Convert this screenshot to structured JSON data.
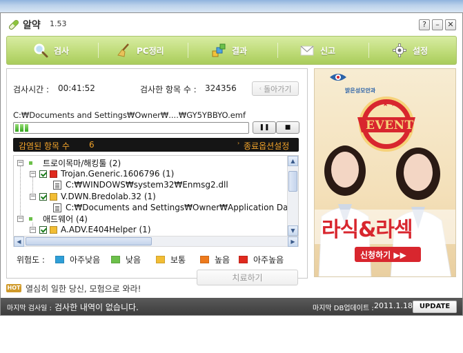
{
  "app": {
    "title": "알약",
    "version": "1.53"
  },
  "window_controls": {
    "help": "?",
    "minimize": "–",
    "close": "✕"
  },
  "toolbar": {
    "items": [
      {
        "label": "검사",
        "icon": "magnifier-icon"
      },
      {
        "label": "PC정리",
        "icon": "broom-icon"
      },
      {
        "label": "결과",
        "icon": "result-boxes-icon"
      },
      {
        "label": "신고",
        "icon": "envelope-icon"
      },
      {
        "label": "설정",
        "icon": "gear-icon"
      }
    ]
  },
  "scan": {
    "time_label": "검사시간 :",
    "time_value": "00:41:52",
    "count_label": "검사한 항목 수 :",
    "count_value": "324356",
    "back_button": "돌아가기",
    "current_path": "C:₩Documents and Settings₩Owner₩....₩GY5YBBYO.emf",
    "progress_segments": 3,
    "pause_button": "❚❚",
    "stop_button": "■"
  },
  "infected": {
    "label": "감염된 항목 수",
    "count": "6",
    "options_link": "종료옵션설정"
  },
  "tree": {
    "rows": [
      {
        "level": 0,
        "expander": "-",
        "checkbox": false,
        "marker_color": "#6cc04a",
        "marker": "small",
        "text": "트로이목마/해킹툴 (2)"
      },
      {
        "level": 1,
        "expander": "-",
        "checkbox": true,
        "marker_color": "#e02a1e",
        "text": "Trojan.Generic.1606796 (1)"
      },
      {
        "level": 2,
        "expander": "",
        "checkbox": false,
        "file": true,
        "text": "C:₩WINDOWS₩system32₩Enmsg2.dll"
      },
      {
        "level": 1,
        "expander": "-",
        "checkbox": true,
        "marker_color": "#f2bd34",
        "text": "V.DWN.Bredolab.32 (1)"
      },
      {
        "level": 2,
        "expander": "",
        "checkbox": false,
        "file": true,
        "text": "C:₩Documents and Settings₩Owner₩Application Data₩"
      },
      {
        "level": 0,
        "expander": "-",
        "checkbox": false,
        "marker_color": "#6cc04a",
        "marker": "small",
        "text": "애드웨어 (4)"
      },
      {
        "level": 1,
        "expander": "-",
        "checkbox": true,
        "marker_color": "#f2bd34",
        "text": "A.ADV.E404Helper (1)"
      }
    ]
  },
  "legend": {
    "title": "위험도 :",
    "items": [
      {
        "label": "아주낮음",
        "color": "#2f9fd8"
      },
      {
        "label": "낮음",
        "color": "#6cc04a"
      },
      {
        "label": "보통",
        "color": "#f2bd34"
      },
      {
        "label": "높음",
        "color": "#ee7a1c"
      },
      {
        "label": "아주높음",
        "color": "#e02a1e"
      }
    ]
  },
  "cure_button": "치료하기",
  "ad": {
    "clinic_name": "밝은성모안과",
    "event_badge": "EVENT",
    "headline": "라식&라섹",
    "cta": "신청하기 ▶▶"
  },
  "hot": {
    "badge": "HOT",
    "text": "열심히 일한 당신, 모험으로 와라!"
  },
  "status": {
    "last_scan_label": "마지막 검사일 :",
    "last_scan_value": "검사한 내역이 없습니다.",
    "db_update_label": "마지막 DB업데이트 :",
    "db_update_value": "2011.1.18",
    "update_button": "UPDATE"
  },
  "colors": {
    "toolbar_green": "#b5d46a",
    "infected_bar": "#151515",
    "accent_orange": "#f0a22a",
    "ad_red": "#d8262e"
  }
}
